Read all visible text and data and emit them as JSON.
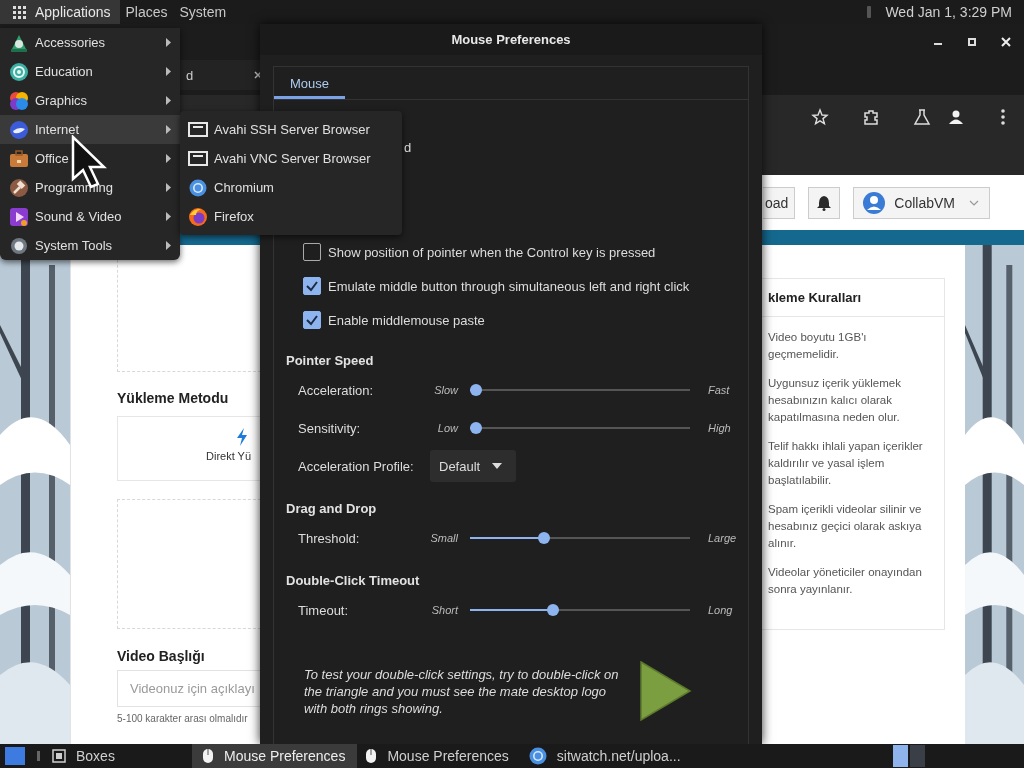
{
  "top_panel": {
    "menus": [
      {
        "label": "Applications",
        "selected": true,
        "kind": "grid"
      },
      {
        "label": "Places",
        "selected": false
      },
      {
        "label": "System",
        "selected": false
      }
    ],
    "clock": "Wed Jan 1, 3:29 PM"
  },
  "browser": {
    "tab_title": "d",
    "toolbar_icons": [
      {
        "kind": "star"
      },
      {
        "kind": "puzzle"
      },
      {
        "kind": "flask"
      },
      {
        "kind": "person"
      },
      {
        "kind": "dots"
      }
    ],
    "page": {
      "header": {
        "upload_button": "oad",
        "user_menu": "CollabVM"
      },
      "left_column": [
        {
          "kind": "dashed"
        },
        {
          "kind": "heading",
          "text": "Yükleme Metodu"
        },
        {
          "kind": "method",
          "text": "Direkt Yü"
        },
        {
          "kind": "dashed"
        },
        {
          "kind": "heading",
          "text": "Video Başlığı"
        },
        {
          "kind": "input",
          "placeholder": "Videonuz için açıklayı"
        },
        {
          "kind": "hint",
          "text": "5-100 karakter arası olmalıdır"
        }
      ],
      "rules": {
        "title": "kleme Kuralları",
        "items": [
          "Video boyutu 1GB'ı geçmemelidir.",
          "Uygunsuz içerik yüklemek hesabınızın kalıcı olarak kapatılmasına neden olur.",
          "Telif hakkı ihlali yapan içerikler kaldırılır ve yasal işlem başlatılabilir.",
          "Spam içerikli videolar silinir ve hesabınız geçici olarak askıya alınır.",
          "Videolar yöneticiler onayından sonra yayınlanır."
        ]
      }
    }
  },
  "mouse_dialog": {
    "title": "Mouse Preferences",
    "tabs": [
      {
        "label": "Mouse",
        "selected": true
      }
    ],
    "partial_label": "d",
    "checkboxes": [
      {
        "label": "Show position of pointer when the Control key is pressed",
        "checked": false
      },
      {
        "label": "Emulate middle button through simultaneous left and right click",
        "checked": true
      },
      {
        "label": "Enable middlemouse paste",
        "checked": true
      }
    ],
    "sections": [
      {
        "title": "Pointer Speed",
        "rows": [
          {
            "kind": "slider",
            "label": "Acceleration:",
            "min_label": "Slow",
            "max_label": "Fast",
            "level": 0
          },
          {
            "kind": "slider",
            "label": "Sensitivity:",
            "min_label": "Low",
            "max_label": "High",
            "level": 0
          },
          {
            "kind": "dropdown",
            "label": "Acceleration Profile:",
            "value": "Default"
          }
        ]
      },
      {
        "title": "Drag and Drop",
        "rows": [
          {
            "kind": "slider",
            "label": "Threshold:",
            "min_label": "Small",
            "max_label": "Large",
            "level": 0.32
          }
        ]
      },
      {
        "title": "Double-Click Timeout",
        "rows": [
          {
            "kind": "slider",
            "label": "Timeout:",
            "min_label": "Short",
            "max_label": "Long",
            "level": 0.36
          }
        ]
      }
    ],
    "test_text": "To test your double-click settings, try to double-click on the triangle and you must see the mate desktop logo with both rings showing."
  },
  "applications_menu": {
    "items": [
      {
        "label": "Accessories",
        "kind": "accessories",
        "selected": false
      },
      {
        "label": "Education",
        "kind": "education",
        "selected": false
      },
      {
        "label": "Graphics",
        "kind": "graphics",
        "selected": false
      },
      {
        "label": "Internet",
        "kind": "internet",
        "selected": true
      },
      {
        "label": "Office",
        "kind": "office",
        "selected": false
      },
      {
        "label": "Programming",
        "kind": "programming",
        "selected": false
      },
      {
        "label": "Sound & Video",
        "kind": "sound",
        "selected": false
      },
      {
        "label": "System Tools",
        "kind": "system",
        "selected": false
      }
    ],
    "submenu": [
      {
        "label": "Avahi SSH Server Browser",
        "kind": "monitor"
      },
      {
        "label": "Avahi VNC Server Browser",
        "kind": "monitor"
      },
      {
        "label": "Chromium",
        "kind": "chromium"
      },
      {
        "label": "Firefox",
        "kind": "firefox"
      }
    ]
  },
  "taskbar": {
    "items": [
      {
        "label": "Boxes",
        "kind": "boxes",
        "selected": false
      },
      {
        "label": "Mouse Preferences",
        "kind": "mouse",
        "selected": true
      },
      {
        "label": "Mouse Preferences",
        "kind": "mouse",
        "selected": false
      },
      {
        "label": "sitwatch.net/uploa...",
        "kind": "chromium",
        "selected": false
      }
    ]
  }
}
